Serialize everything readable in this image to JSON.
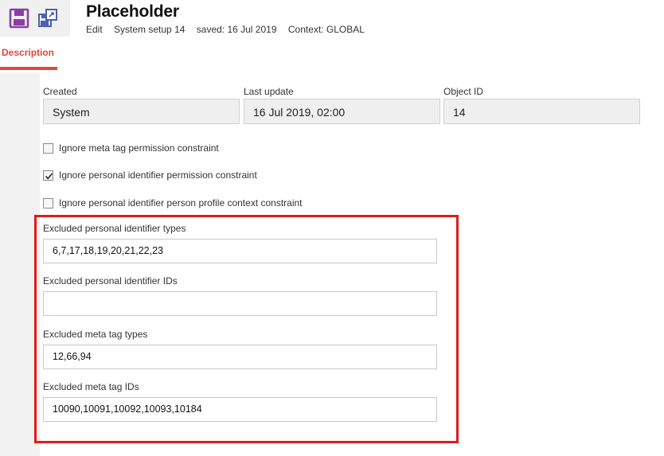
{
  "header": {
    "title": "Placeholder",
    "meta": [
      "Edit",
      "System setup 14",
      "saved: 16 Jul 2019",
      "Context: GLOBAL"
    ],
    "icons": [
      "save-icon",
      "save-as-icon"
    ],
    "icon_color": "#8a3ea6"
  },
  "tabs": [
    {
      "label": "Description",
      "active": true
    }
  ],
  "info": {
    "created": {
      "label": "Created",
      "value": "System"
    },
    "last_update": {
      "label": "Last update",
      "value": "16 Jul 2019, 02:00"
    },
    "object_id": {
      "label": "Object ID",
      "value": "14"
    }
  },
  "checkboxes": [
    {
      "label": "Ignore meta tag permission constraint",
      "checked": false
    },
    {
      "label": "Ignore personal identifier permission constraint",
      "checked": true
    },
    {
      "label": "Ignore personal identifier person profile context constraint",
      "checked": false
    }
  ],
  "fields": [
    {
      "label": "Excluded personal identifier types",
      "value": "6,7,17,18,19,20,21,22,23"
    },
    {
      "label": "Excluded personal identifier IDs",
      "value": ""
    },
    {
      "label": "Excluded meta tag types",
      "value": "12,66,94"
    },
    {
      "label": "Excluded meta tag IDs",
      "value": "10090,10091,10092,10093,10184"
    }
  ],
  "colors": {
    "accent": "#e2463d",
    "highlight_border": "#e01b1b"
  }
}
